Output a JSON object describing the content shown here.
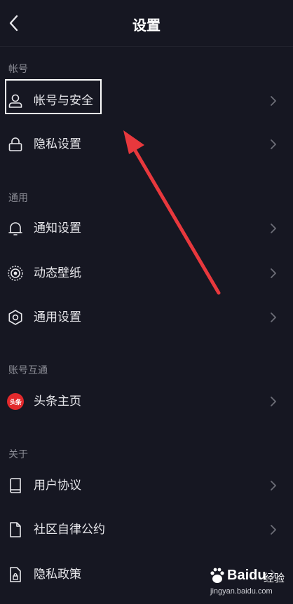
{
  "header": {
    "title": "设置",
    "back_icon": "chevron-left-icon"
  },
  "sections": {
    "account": "帐号",
    "general": "通用",
    "linked": "账号互通",
    "about": "关于"
  },
  "items": {
    "account_security": {
      "label": "帐号与安全",
      "icon": "user-icon"
    },
    "privacy_settings": {
      "label": "隐私设置",
      "icon": "lock-icon"
    },
    "notification_settings": {
      "label": "通知设置",
      "icon": "bell-icon"
    },
    "live_wallpaper": {
      "label": "动态壁纸",
      "icon": "target-icon"
    },
    "general_settings": {
      "label": "通用设置",
      "icon": "gear-icon"
    },
    "toutiao_home": {
      "label": "头条主页",
      "icon": "toutiao-logo",
      "logo_text": "头条"
    },
    "user_agreement": {
      "label": "用户协议",
      "icon": "book-icon"
    },
    "community_rules": {
      "label": "社区自律公约",
      "icon": "document-icon"
    },
    "privacy_policy": {
      "label": "隐私政策",
      "icon": "document-lock-icon"
    }
  },
  "watermark": {
    "brand": "Baidu",
    "sub": "经验",
    "url": "jingyan.baidu.com"
  },
  "colors": {
    "background": "#161722",
    "text": "#e8e8ec",
    "section": "#8b8c95",
    "arrow": "#e8383d",
    "highlight": "#ffffff"
  }
}
